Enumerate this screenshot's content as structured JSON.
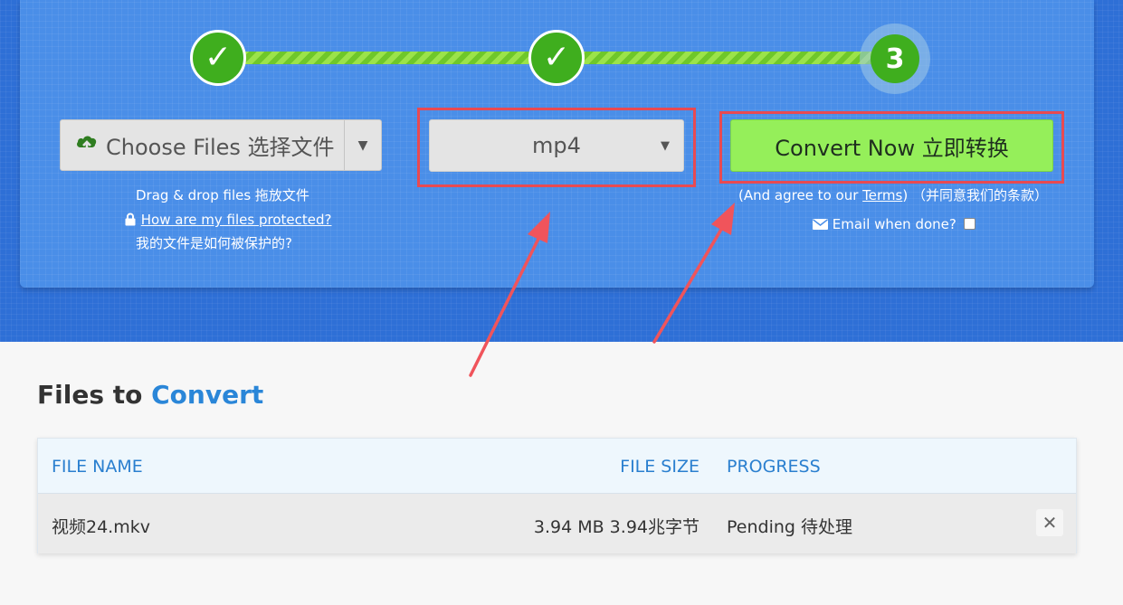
{
  "steps": {
    "step3_label": "3",
    "check_glyph": "✓"
  },
  "choose_files": {
    "label": "Choose Files 选择文件",
    "icon": "cloud-upload-icon",
    "drag_hint": "Drag & drop files 拖放文件",
    "protected_link": "How are my files protected?",
    "protected_cn": "我的文件是如何被保护的?"
  },
  "format": {
    "selected": "mp4"
  },
  "convert": {
    "label": "Convert Now 立即转换",
    "agree_prefix": "(And agree to our ",
    "terms_link": "Terms",
    "agree_suffix": ") （并同意我们的条款）",
    "email_label": "Email when done?"
  },
  "files": {
    "title_part1": "Files to ",
    "title_part2": "Convert",
    "columns": {
      "name": "FILE NAME",
      "size": "FILE SIZE",
      "progress": "PROGRESS"
    },
    "rows": [
      {
        "name": "视频24.mkv",
        "size": "3.94 MB 3.94兆字节",
        "progress": "Pending 待处理"
      }
    ]
  },
  "colors": {
    "accent": "#2a86d8",
    "step_green": "#3fae1e",
    "convert_green": "#95ef5a",
    "highlight_red": "#e84a52"
  }
}
